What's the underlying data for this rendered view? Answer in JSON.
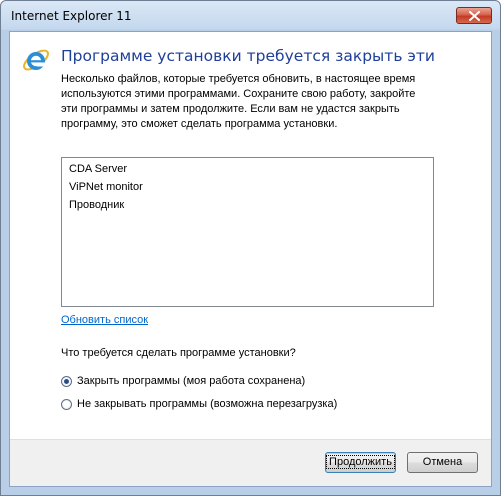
{
  "window": {
    "title": "Internet Explorer 11",
    "close_icon": "close-icon"
  },
  "heading": "Программе установки требуется закрыть эти",
  "description": {
    "line1": "Несколько файлов, которые требуется обновить, в настоящее время",
    "line2": "используются этими программами. Сохраните свою работу, закройте",
    "line3": "эти программы и затем продолжите. Если вам не удастся закрыть",
    "line4": "программу, это сможет сделать программа установки."
  },
  "programs": [
    "CDA Server",
    "ViPNet monitor",
    "Проводник"
  ],
  "refresh_link": "Обновить список",
  "question": "Что требуется сделать программе установки?",
  "options": [
    {
      "label": "Закрыть программы (моя работа сохранена)",
      "selected": true
    },
    {
      "label": "Не закрывать программы (возможна перезагрузка)",
      "selected": false
    }
  ],
  "buttons": {
    "continue": "Продолжить",
    "cancel": "Отмена"
  },
  "icons": {
    "app": "internet-explorer-icon"
  },
  "colors": {
    "heading": "#1e3f9a",
    "link": "#0066cc",
    "close_button": "#c33b22"
  }
}
